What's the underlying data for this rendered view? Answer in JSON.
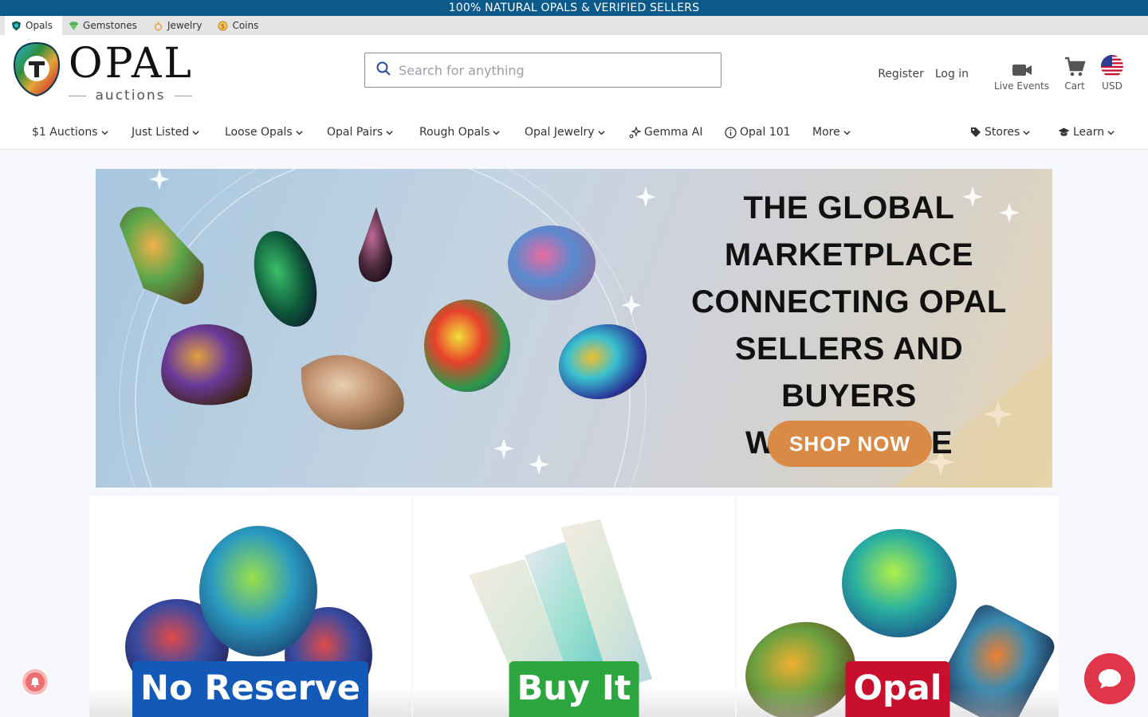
{
  "announcement": "100% NATURAL OPALS & VERIFIED SELLERS",
  "site_tabs": [
    {
      "label": "Opals",
      "icon": "opal-shield-icon"
    },
    {
      "label": "Gemstones",
      "icon": "gemstone-icon"
    },
    {
      "label": "Jewelry",
      "icon": "ring-icon"
    },
    {
      "label": "Coins",
      "icon": "coin-icon"
    }
  ],
  "logo": {
    "word": "OPAL",
    "sub": "auctions"
  },
  "search": {
    "placeholder": "Search for anything"
  },
  "header": {
    "register": "Register",
    "login": "Log in",
    "live_events": "Live Events",
    "cart": "Cart",
    "currency": "USD"
  },
  "nav": [
    {
      "label": "$1 Auctions"
    },
    {
      "label": "Just Listed"
    },
    {
      "label": "Loose Opals"
    },
    {
      "label": "Opal Pairs"
    },
    {
      "label": "Rough Opals"
    },
    {
      "label": "Opal Jewelry"
    },
    {
      "label": "Gemma AI"
    },
    {
      "label": "Opal 101"
    },
    {
      "label": "More"
    },
    {
      "label": "Stores"
    },
    {
      "label": "Learn"
    }
  ],
  "hero": {
    "lines": [
      "THE GLOBAL",
      "MARKETPLACE",
      "CONNECTING OPAL",
      "SELLERS AND BUYERS",
      "WORLDWIDE"
    ],
    "cta": "SHOP NOW"
  },
  "cards": [
    {
      "label": "No Reserve",
      "color": "#1259b8"
    },
    {
      "label": "Buy It",
      "color": "#2ea640"
    },
    {
      "label": "Opal",
      "color": "#c8102e"
    }
  ],
  "colors": {
    "topbar": "#0b5a8a",
    "chat": "#e0364a",
    "cta": "#d98a45"
  }
}
